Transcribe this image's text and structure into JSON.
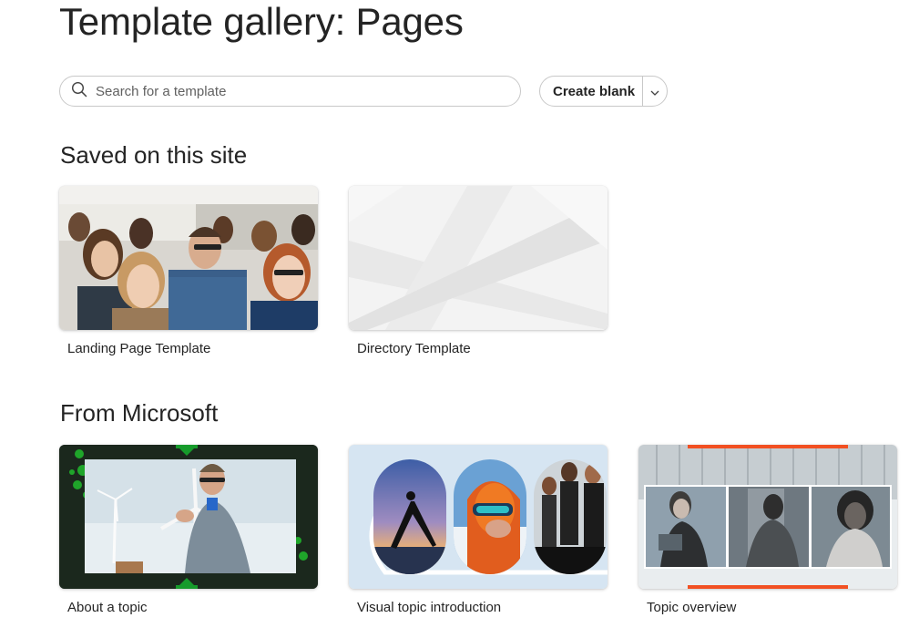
{
  "page": {
    "title": "Template gallery: Pages"
  },
  "search": {
    "placeholder": "Search for a template",
    "icon": "search-icon"
  },
  "create": {
    "label": "Create blank",
    "dropdown_icon": "chevron-down-icon"
  },
  "sections": [
    {
      "heading": "Saved on this site",
      "templates": [
        {
          "label": "Landing Page Template",
          "thumbnail": "photo-audience"
        },
        {
          "label": "Directory Template",
          "thumbnail": "abstract-gray"
        }
      ]
    },
    {
      "heading": "From Microsoft",
      "templates": [
        {
          "label": "About a topic",
          "thumbnail": "man-wind-turbine"
        },
        {
          "label": "Visual topic introduction",
          "thumbnail": "pill-photos"
        },
        {
          "label": "Topic overview",
          "thumbnail": "three-portraits"
        }
      ]
    }
  ],
  "colors": {
    "text": "#242424",
    "border": "#c8c8c8",
    "accent_orange": "#f25022",
    "accent_green": "#107c10"
  }
}
